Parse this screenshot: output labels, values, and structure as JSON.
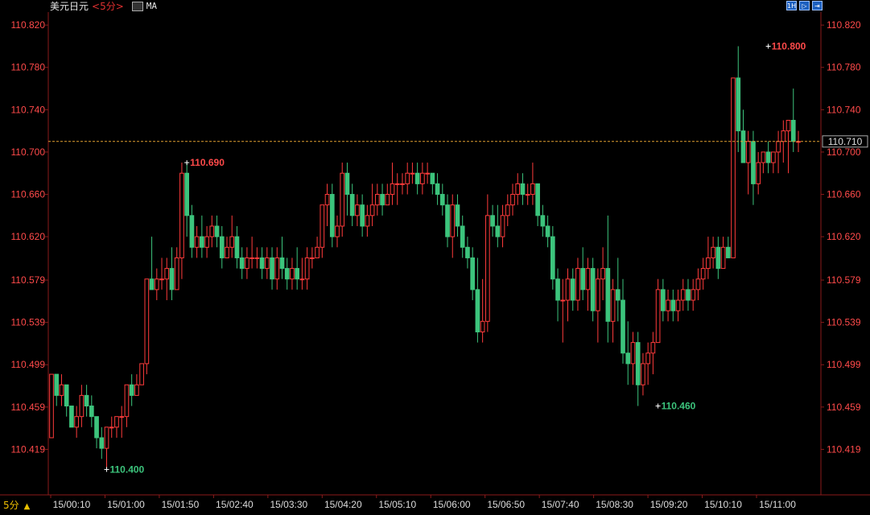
{
  "header": {
    "symbol": "美元日元",
    "period": "<5分>",
    "indicator": "MA"
  },
  "toolbar": {
    "btn1": "1H",
    "btn2": "▷",
    "btn3": "⇥"
  },
  "footer": {
    "period_label": "5分",
    "arrow": "▲"
  },
  "colors": {
    "up": "#ff3b3b",
    "down": "#3cc47c",
    "axis": "#8b1a1a",
    "last_line": "#e0a030",
    "label_red": "#ff4a4a",
    "label_green": "#3cc47c"
  },
  "chart_data": {
    "type": "candlestick",
    "y_ticks": [
      "110.419",
      "110.459",
      "110.499",
      "110.539",
      "110.579",
      "110.620",
      "110.660",
      "110.700",
      "110.740",
      "110.780",
      "110.820"
    ],
    "y_min": 110.395,
    "y_max": 110.83,
    "x_ticks": [
      "15/00:10",
      "15/01:00",
      "15/01:50",
      "15/02:40",
      "15/03:30",
      "15/04:20",
      "15/05:10",
      "15/06:00",
      "15/06:50",
      "15/07:40",
      "15/08:30",
      "15/09:20",
      "15/10:10",
      "15/11:00"
    ],
    "last_price": "110.710",
    "annotations": [
      {
        "label": "110.690",
        "value": 110.69,
        "bar": 27,
        "color": "red"
      },
      {
        "label": "110.400",
        "value": 110.4,
        "bar": 11,
        "color": "green"
      },
      {
        "label": "110.800",
        "value": 110.8,
        "bar": 143,
        "color": "red"
      },
      {
        "label": "110.460",
        "value": 110.46,
        "bar": 121,
        "color": "green"
      }
    ],
    "candles": [
      [
        110.43,
        110.49,
        110.43,
        110.49
      ],
      [
        110.49,
        110.49,
        110.46,
        110.47
      ],
      [
        110.47,
        110.49,
        110.46,
        110.48
      ],
      [
        110.48,
        110.48,
        110.45,
        110.46
      ],
      [
        110.46,
        110.46,
        110.44,
        110.44
      ],
      [
        110.44,
        110.46,
        110.43,
        110.45
      ],
      [
        110.45,
        110.48,
        110.44,
        110.47
      ],
      [
        110.47,
        110.48,
        110.45,
        110.46
      ],
      [
        110.46,
        110.47,
        110.44,
        110.45
      ],
      [
        110.45,
        110.45,
        110.42,
        110.43
      ],
      [
        110.43,
        110.44,
        110.41,
        110.42
      ],
      [
        110.42,
        110.44,
        110.4,
        110.44
      ],
      [
        110.44,
        110.45,
        110.43,
        110.44
      ],
      [
        110.44,
        110.45,
        110.43,
        110.45
      ],
      [
        110.45,
        110.46,
        110.43,
        110.45
      ],
      [
        110.45,
        110.48,
        110.44,
        110.48
      ],
      [
        110.48,
        110.49,
        110.46,
        110.47
      ],
      [
        110.47,
        110.49,
        110.47,
        110.48
      ],
      [
        110.48,
        110.5,
        110.48,
        110.5
      ],
      [
        110.5,
        110.58,
        110.49,
        110.58
      ],
      [
        110.58,
        110.62,
        110.57,
        110.57
      ],
      [
        110.57,
        110.59,
        110.56,
        110.58
      ],
      [
        110.58,
        110.6,
        110.57,
        110.58
      ],
      [
        110.58,
        110.6,
        110.56,
        110.59
      ],
      [
        110.59,
        110.61,
        110.56,
        110.57
      ],
      [
        110.57,
        110.61,
        110.57,
        110.6
      ],
      [
        110.6,
        110.69,
        110.58,
        110.68
      ],
      [
        110.68,
        110.69,
        110.62,
        110.64
      ],
      [
        110.64,
        110.65,
        110.6,
        110.61
      ],
      [
        110.61,
        110.63,
        110.6,
        110.62
      ],
      [
        110.62,
        110.64,
        110.6,
        110.61
      ],
      [
        110.61,
        110.63,
        110.6,
        110.62
      ],
      [
        110.62,
        110.64,
        110.61,
        110.63
      ],
      [
        110.63,
        110.64,
        110.61,
        110.62
      ],
      [
        110.62,
        110.63,
        110.59,
        110.6
      ],
      [
        110.6,
        110.62,
        110.6,
        110.61
      ],
      [
        110.61,
        110.64,
        110.6,
        110.62
      ],
      [
        110.62,
        110.63,
        110.59,
        110.6
      ],
      [
        110.6,
        110.61,
        110.58,
        110.59
      ],
      [
        110.59,
        110.61,
        110.58,
        110.6
      ],
      [
        110.6,
        110.62,
        110.59,
        110.6
      ],
      [
        110.6,
        110.61,
        110.59,
        110.6
      ],
      [
        110.6,
        110.61,
        110.58,
        110.59
      ],
      [
        110.59,
        110.61,
        110.58,
        110.6
      ],
      [
        110.6,
        110.61,
        110.57,
        110.58
      ],
      [
        110.58,
        110.61,
        110.57,
        110.6
      ],
      [
        110.6,
        110.62,
        110.58,
        110.59
      ],
      [
        110.59,
        110.6,
        110.57,
        110.58
      ],
      [
        110.58,
        110.6,
        110.57,
        110.59
      ],
      [
        110.59,
        110.61,
        110.57,
        110.58
      ],
      [
        110.58,
        110.6,
        110.57,
        110.58
      ],
      [
        110.58,
        110.61,
        110.57,
        110.6
      ],
      [
        110.6,
        110.61,
        110.59,
        110.6
      ],
      [
        110.6,
        110.62,
        110.6,
        110.61
      ],
      [
        110.61,
        110.65,
        110.6,
        110.65
      ],
      [
        110.65,
        110.67,
        110.63,
        110.66
      ],
      [
        110.66,
        110.67,
        110.61,
        110.62
      ],
      [
        110.62,
        110.64,
        110.61,
        110.63
      ],
      [
        110.63,
        110.69,
        110.62,
        110.68
      ],
      [
        110.68,
        110.69,
        110.64,
        110.66
      ],
      [
        110.66,
        110.67,
        110.63,
        110.64
      ],
      [
        110.64,
        110.66,
        110.63,
        110.65
      ],
      [
        110.65,
        110.66,
        110.62,
        110.63
      ],
      [
        110.63,
        110.65,
        110.62,
        110.64
      ],
      [
        110.64,
        110.67,
        110.63,
        110.65
      ],
      [
        110.65,
        110.67,
        110.64,
        110.66
      ],
      [
        110.66,
        110.67,
        110.64,
        110.65
      ],
      [
        110.65,
        110.67,
        110.65,
        110.66
      ],
      [
        110.66,
        110.69,
        110.65,
        110.67
      ],
      [
        110.67,
        110.68,
        110.65,
        110.67
      ],
      [
        110.67,
        110.68,
        110.66,
        110.67
      ],
      [
        110.67,
        110.69,
        110.66,
        110.68
      ],
      [
        110.68,
        110.69,
        110.67,
        110.68
      ],
      [
        110.68,
        110.69,
        110.66,
        110.67
      ],
      [
        110.67,
        110.69,
        110.66,
        110.68
      ],
      [
        110.68,
        110.69,
        110.67,
        110.68
      ],
      [
        110.68,
        110.68,
        110.66,
        110.67
      ],
      [
        110.67,
        110.68,
        110.65,
        110.66
      ],
      [
        110.66,
        110.67,
        110.64,
        110.65
      ],
      [
        110.65,
        110.66,
        110.61,
        110.62
      ],
      [
        110.62,
        110.66,
        110.6,
        110.65
      ],
      [
        110.65,
        110.66,
        110.62,
        110.63
      ],
      [
        110.63,
        110.64,
        110.6,
        110.61
      ],
      [
        110.61,
        110.62,
        110.59,
        110.6
      ],
      [
        110.6,
        110.61,
        110.56,
        110.57
      ],
      [
        110.57,
        110.6,
        110.52,
        110.53
      ],
      [
        110.53,
        110.58,
        110.52,
        110.54
      ],
      [
        110.54,
        110.66,
        110.53,
        110.64
      ],
      [
        110.64,
        110.65,
        110.62,
        110.63
      ],
      [
        110.63,
        110.65,
        110.61,
        110.62
      ],
      [
        110.62,
        110.65,
        110.61,
        110.64
      ],
      [
        110.64,
        110.66,
        110.63,
        110.65
      ],
      [
        110.65,
        110.67,
        110.64,
        110.66
      ],
      [
        110.66,
        110.68,
        110.65,
        110.67
      ],
      [
        110.67,
        110.68,
        110.65,
        110.66
      ],
      [
        110.66,
        110.67,
        110.65,
        110.66
      ],
      [
        110.66,
        110.69,
        110.65,
        110.67
      ],
      [
        110.67,
        110.67,
        110.63,
        110.64
      ],
      [
        110.64,
        110.65,
        110.62,
        110.63
      ],
      [
        110.63,
        110.64,
        110.61,
        110.62
      ],
      [
        110.62,
        110.63,
        110.57,
        110.58
      ],
      [
        110.58,
        110.59,
        110.54,
        110.56
      ],
      [
        110.56,
        110.58,
        110.52,
        110.56
      ],
      [
        110.56,
        110.59,
        110.54,
        110.58
      ],
      [
        110.58,
        110.59,
        110.55,
        110.56
      ],
      [
        110.56,
        110.6,
        110.55,
        110.59
      ],
      [
        110.59,
        110.61,
        110.56,
        110.57
      ],
      [
        110.57,
        110.6,
        110.55,
        110.59
      ],
      [
        110.59,
        110.6,
        110.54,
        110.55
      ],
      [
        110.55,
        110.59,
        110.52,
        110.58
      ],
      [
        110.58,
        110.61,
        110.56,
        110.59
      ],
      [
        110.59,
        110.64,
        110.52,
        110.54
      ],
      [
        110.54,
        110.58,
        110.52,
        110.57
      ],
      [
        110.57,
        110.6,
        110.54,
        110.56
      ],
      [
        110.56,
        110.58,
        110.5,
        110.51
      ],
      [
        110.51,
        110.54,
        110.48,
        110.5
      ],
      [
        110.5,
        110.53,
        110.48,
        110.52
      ],
      [
        110.52,
        110.53,
        110.46,
        110.48
      ],
      [
        110.48,
        110.51,
        110.47,
        110.5
      ],
      [
        110.5,
        110.52,
        110.48,
        110.51
      ],
      [
        110.51,
        110.53,
        110.49,
        110.52
      ],
      [
        110.52,
        110.58,
        110.52,
        110.57
      ],
      [
        110.57,
        110.58,
        110.54,
        110.55
      ],
      [
        110.55,
        110.57,
        110.54,
        110.56
      ],
      [
        110.56,
        110.57,
        110.54,
        110.55
      ],
      [
        110.55,
        110.57,
        110.54,
        110.56
      ],
      [
        110.56,
        110.58,
        110.55,
        110.57
      ],
      [
        110.57,
        110.58,
        110.55,
        110.56
      ],
      [
        110.56,
        110.58,
        110.55,
        110.57
      ],
      [
        110.57,
        110.59,
        110.56,
        110.58
      ],
      [
        110.58,
        110.6,
        110.57,
        110.59
      ],
      [
        110.59,
        110.62,
        110.58,
        110.6
      ],
      [
        110.6,
        110.62,
        110.59,
        110.61
      ],
      [
        110.61,
        110.62,
        110.58,
        110.59
      ],
      [
        110.59,
        110.62,
        110.59,
        110.61
      ],
      [
        110.61,
        110.62,
        110.6,
        110.6
      ],
      [
        110.6,
        110.77,
        110.6,
        110.77
      ],
      [
        110.77,
        110.8,
        110.7,
        110.72
      ],
      [
        110.72,
        110.74,
        110.69,
        110.69
      ],
      [
        110.69,
        110.72,
        110.66,
        110.71
      ],
      [
        110.71,
        110.72,
        110.65,
        110.67
      ],
      [
        110.67,
        110.7,
        110.66,
        110.69
      ],
      [
        110.69,
        110.7,
        110.68,
        110.7
      ],
      [
        110.7,
        110.71,
        110.68,
        110.69
      ],
      [
        110.69,
        110.7,
        110.68,
        110.7
      ],
      [
        110.7,
        110.72,
        110.68,
        110.71
      ],
      [
        110.71,
        110.73,
        110.69,
        110.72
      ],
      [
        110.72,
        110.73,
        110.68,
        110.73
      ],
      [
        110.73,
        110.76,
        110.7,
        110.71
      ],
      [
        110.71,
        110.72,
        110.7,
        110.71
      ]
    ]
  }
}
